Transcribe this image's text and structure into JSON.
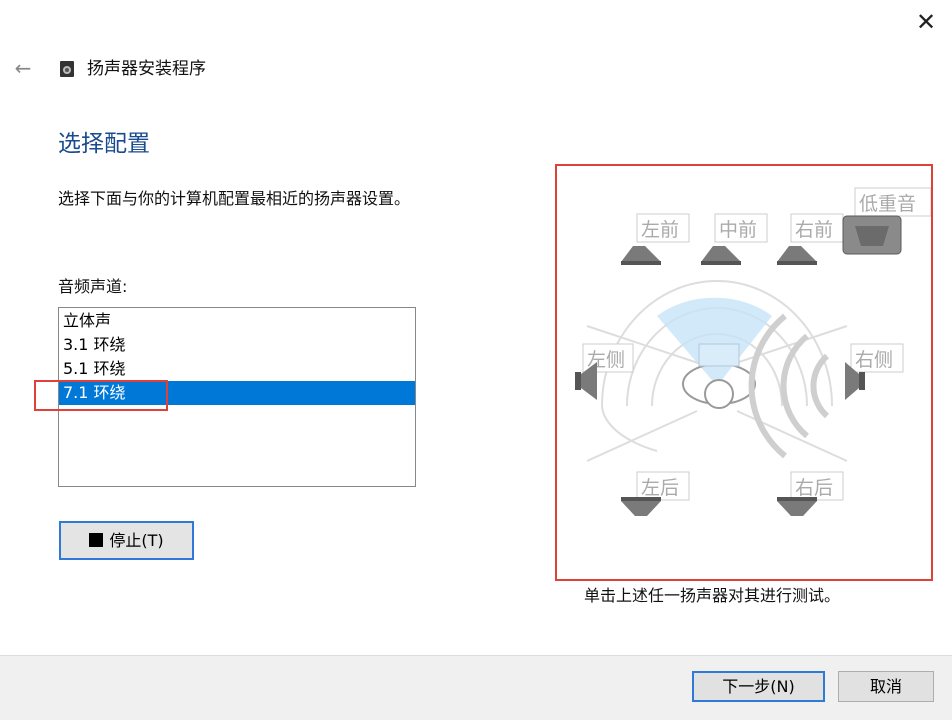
{
  "window": {
    "title": "扬声器安装程序",
    "close_glyph": "✕",
    "back_glyph": "←"
  },
  "page": {
    "heading": "选择配置",
    "description": "选择下面与你的计算机配置最相近的扬声器设置。",
    "channel_label": "音频声道:",
    "channels": [
      "立体声",
      "3.1 环绕",
      "5.1 环绕",
      "7.1 环绕"
    ],
    "selected_channel": "7.1 环绕",
    "stop_button": "停止(T)",
    "hint": "单击上述任一扬声器对其进行测试。"
  },
  "speakers": {
    "front_left": "左前",
    "front_center": "中前",
    "front_right": "右前",
    "subwoofer": "低重音",
    "side_left": "左侧",
    "side_right": "右侧",
    "rear_left": "左后",
    "rear_right": "右后"
  },
  "footer": {
    "next_button": "下一步(N)",
    "cancel_button": "取消"
  },
  "colors": {
    "accent": "#0078d7",
    "heading": "#1a4a8f",
    "highlight_border": "#e0403a",
    "focus_border": "#2e7ad6"
  },
  "icons": {
    "app": "speaker-icon",
    "back": "back-arrow-icon",
    "close": "close-icon",
    "stop": "stop-square-icon"
  }
}
